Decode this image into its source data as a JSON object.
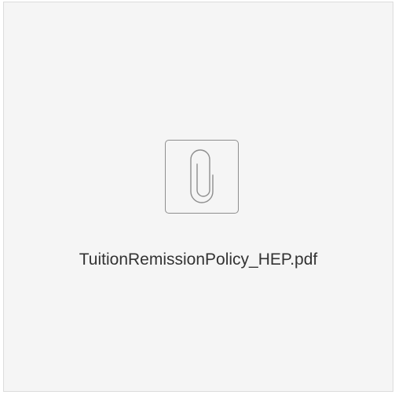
{
  "attachment": {
    "file_name": "TuitionRemissionPolicy_HEP.pdf",
    "icon": "paperclip-icon",
    "colors": {
      "card_background": "#f5f5f5",
      "card_border": "#dcdcdc",
      "icon_stroke": "#8e8e8e",
      "text": "#333333"
    }
  }
}
